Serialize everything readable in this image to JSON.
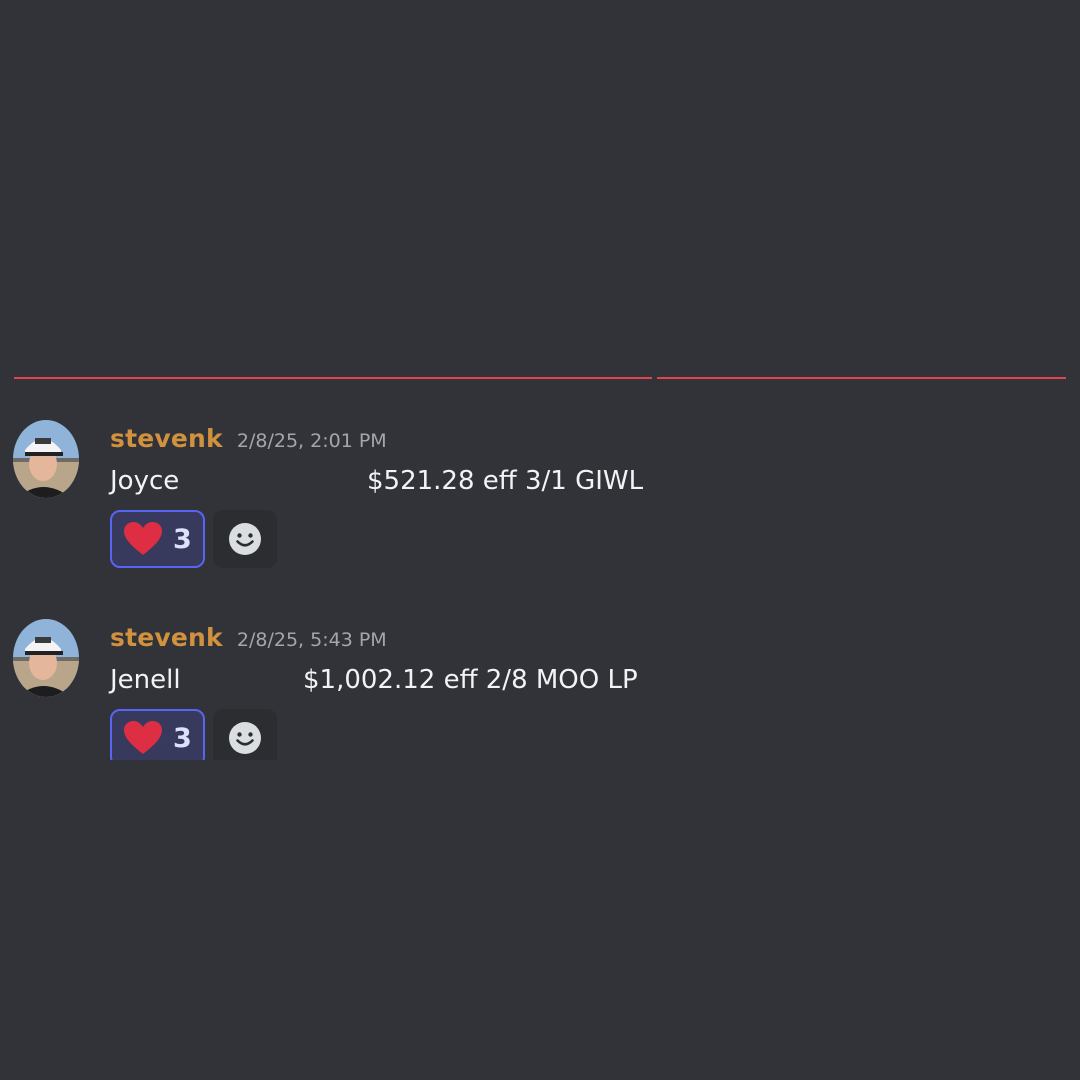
{
  "messages": [
    {
      "username": "stevenk",
      "timestamp": "2/8/25, 2:01 PM",
      "name": "Joyce",
      "detail": "$521.28 eff 3/1 GIWL",
      "reaction": {
        "emoji": "heart-icon",
        "count": "3"
      }
    },
    {
      "username": "stevenk",
      "timestamp": "2/8/25, 5:43 PM",
      "name": "Jenell",
      "detail": "$1,002.12 eff 2/8 MOO LP",
      "reaction": {
        "emoji": "heart-icon",
        "count": "3"
      }
    }
  ],
  "colors": {
    "background": "#313338",
    "new_messages_divider": "#e0454b",
    "username": "#d1913f",
    "reaction_border": "#5865f2"
  }
}
